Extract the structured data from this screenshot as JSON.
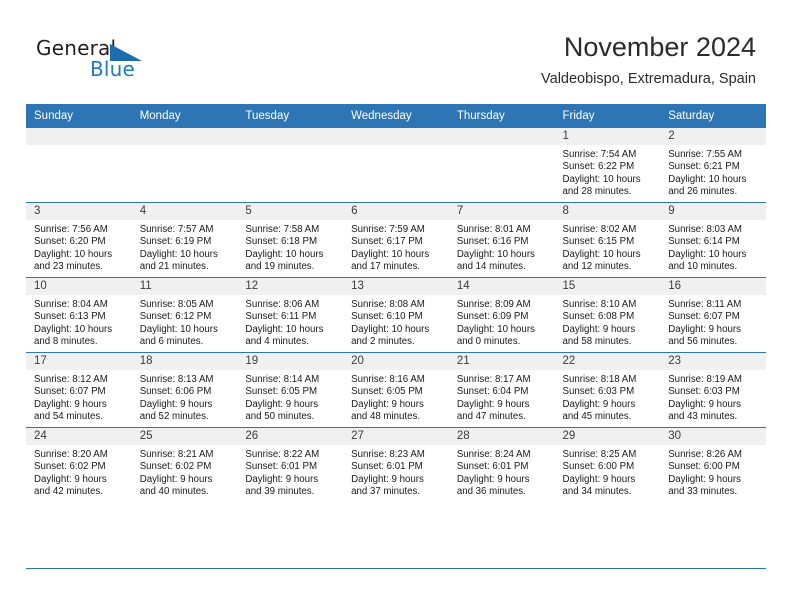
{
  "brand": {
    "name_part1": "General",
    "name_part2": "Blue",
    "logo_icon": "triangle-logo-icon",
    "accent_color": "#1d6cb0"
  },
  "header": {
    "title": "November 2024",
    "location": "Valdeobispo, Extremadura, Spain"
  },
  "theme": {
    "header_blue": "#2e75b6",
    "daynum_band": "#f0f0f0",
    "text": "#1a1a1a"
  },
  "weekday_headers": [
    "Sunday",
    "Monday",
    "Tuesday",
    "Wednesday",
    "Thursday",
    "Friday",
    "Saturday"
  ],
  "weeks": [
    [
      {
        "day": "",
        "sunrise": "",
        "sunset": "",
        "daylight_line1": "",
        "daylight_line2": ""
      },
      {
        "day": "",
        "sunrise": "",
        "sunset": "",
        "daylight_line1": "",
        "daylight_line2": ""
      },
      {
        "day": "",
        "sunrise": "",
        "sunset": "",
        "daylight_line1": "",
        "daylight_line2": ""
      },
      {
        "day": "",
        "sunrise": "",
        "sunset": "",
        "daylight_line1": "",
        "daylight_line2": ""
      },
      {
        "day": "",
        "sunrise": "",
        "sunset": "",
        "daylight_line1": "",
        "daylight_line2": ""
      },
      {
        "day": "1",
        "sunrise": "Sunrise: 7:54 AM",
        "sunset": "Sunset: 6:22 PM",
        "daylight_line1": "Daylight: 10 hours",
        "daylight_line2": "and 28 minutes."
      },
      {
        "day": "2",
        "sunrise": "Sunrise: 7:55 AM",
        "sunset": "Sunset: 6:21 PM",
        "daylight_line1": "Daylight: 10 hours",
        "daylight_line2": "and 26 minutes."
      }
    ],
    [
      {
        "day": "3",
        "sunrise": "Sunrise: 7:56 AM",
        "sunset": "Sunset: 6:20 PM",
        "daylight_line1": "Daylight: 10 hours",
        "daylight_line2": "and 23 minutes."
      },
      {
        "day": "4",
        "sunrise": "Sunrise: 7:57 AM",
        "sunset": "Sunset: 6:19 PM",
        "daylight_line1": "Daylight: 10 hours",
        "daylight_line2": "and 21 minutes."
      },
      {
        "day": "5",
        "sunrise": "Sunrise: 7:58 AM",
        "sunset": "Sunset: 6:18 PM",
        "daylight_line1": "Daylight: 10 hours",
        "daylight_line2": "and 19 minutes."
      },
      {
        "day": "6",
        "sunrise": "Sunrise: 7:59 AM",
        "sunset": "Sunset: 6:17 PM",
        "daylight_line1": "Daylight: 10 hours",
        "daylight_line2": "and 17 minutes."
      },
      {
        "day": "7",
        "sunrise": "Sunrise: 8:01 AM",
        "sunset": "Sunset: 6:16 PM",
        "daylight_line1": "Daylight: 10 hours",
        "daylight_line2": "and 14 minutes."
      },
      {
        "day": "8",
        "sunrise": "Sunrise: 8:02 AM",
        "sunset": "Sunset: 6:15 PM",
        "daylight_line1": "Daylight: 10 hours",
        "daylight_line2": "and 12 minutes."
      },
      {
        "day": "9",
        "sunrise": "Sunrise: 8:03 AM",
        "sunset": "Sunset: 6:14 PM",
        "daylight_line1": "Daylight: 10 hours",
        "daylight_line2": "and 10 minutes."
      }
    ],
    [
      {
        "day": "10",
        "sunrise": "Sunrise: 8:04 AM",
        "sunset": "Sunset: 6:13 PM",
        "daylight_line1": "Daylight: 10 hours",
        "daylight_line2": "and 8 minutes."
      },
      {
        "day": "11",
        "sunrise": "Sunrise: 8:05 AM",
        "sunset": "Sunset: 6:12 PM",
        "daylight_line1": "Daylight: 10 hours",
        "daylight_line2": "and 6 minutes."
      },
      {
        "day": "12",
        "sunrise": "Sunrise: 8:06 AM",
        "sunset": "Sunset: 6:11 PM",
        "daylight_line1": "Daylight: 10 hours",
        "daylight_line2": "and 4 minutes."
      },
      {
        "day": "13",
        "sunrise": "Sunrise: 8:08 AM",
        "sunset": "Sunset: 6:10 PM",
        "daylight_line1": "Daylight: 10 hours",
        "daylight_line2": "and 2 minutes."
      },
      {
        "day": "14",
        "sunrise": "Sunrise: 8:09 AM",
        "sunset": "Sunset: 6:09 PM",
        "daylight_line1": "Daylight: 10 hours",
        "daylight_line2": "and 0 minutes."
      },
      {
        "day": "15",
        "sunrise": "Sunrise: 8:10 AM",
        "sunset": "Sunset: 6:08 PM",
        "daylight_line1": "Daylight: 9 hours",
        "daylight_line2": "and 58 minutes."
      },
      {
        "day": "16",
        "sunrise": "Sunrise: 8:11 AM",
        "sunset": "Sunset: 6:07 PM",
        "daylight_line1": "Daylight: 9 hours",
        "daylight_line2": "and 56 minutes."
      }
    ],
    [
      {
        "day": "17",
        "sunrise": "Sunrise: 8:12 AM",
        "sunset": "Sunset: 6:07 PM",
        "daylight_line1": "Daylight: 9 hours",
        "daylight_line2": "and 54 minutes."
      },
      {
        "day": "18",
        "sunrise": "Sunrise: 8:13 AM",
        "sunset": "Sunset: 6:06 PM",
        "daylight_line1": "Daylight: 9 hours",
        "daylight_line2": "and 52 minutes."
      },
      {
        "day": "19",
        "sunrise": "Sunrise: 8:14 AM",
        "sunset": "Sunset: 6:05 PM",
        "daylight_line1": "Daylight: 9 hours",
        "daylight_line2": "and 50 minutes."
      },
      {
        "day": "20",
        "sunrise": "Sunrise: 8:16 AM",
        "sunset": "Sunset: 6:05 PM",
        "daylight_line1": "Daylight: 9 hours",
        "daylight_line2": "and 48 minutes."
      },
      {
        "day": "21",
        "sunrise": "Sunrise: 8:17 AM",
        "sunset": "Sunset: 6:04 PM",
        "daylight_line1": "Daylight: 9 hours",
        "daylight_line2": "and 47 minutes."
      },
      {
        "day": "22",
        "sunrise": "Sunrise: 8:18 AM",
        "sunset": "Sunset: 6:03 PM",
        "daylight_line1": "Daylight: 9 hours",
        "daylight_line2": "and 45 minutes."
      },
      {
        "day": "23",
        "sunrise": "Sunrise: 8:19 AM",
        "sunset": "Sunset: 6:03 PM",
        "daylight_line1": "Daylight: 9 hours",
        "daylight_line2": "and 43 minutes."
      }
    ],
    [
      {
        "day": "24",
        "sunrise": "Sunrise: 8:20 AM",
        "sunset": "Sunset: 6:02 PM",
        "daylight_line1": "Daylight: 9 hours",
        "daylight_line2": "and 42 minutes."
      },
      {
        "day": "25",
        "sunrise": "Sunrise: 8:21 AM",
        "sunset": "Sunset: 6:02 PM",
        "daylight_line1": "Daylight: 9 hours",
        "daylight_line2": "and 40 minutes."
      },
      {
        "day": "26",
        "sunrise": "Sunrise: 8:22 AM",
        "sunset": "Sunset: 6:01 PM",
        "daylight_line1": "Daylight: 9 hours",
        "daylight_line2": "and 39 minutes."
      },
      {
        "day": "27",
        "sunrise": "Sunrise: 8:23 AM",
        "sunset": "Sunset: 6:01 PM",
        "daylight_line1": "Daylight: 9 hours",
        "daylight_line2": "and 37 minutes."
      },
      {
        "day": "28",
        "sunrise": "Sunrise: 8:24 AM",
        "sunset": "Sunset: 6:01 PM",
        "daylight_line1": "Daylight: 9 hours",
        "daylight_line2": "and 36 minutes."
      },
      {
        "day": "29",
        "sunrise": "Sunrise: 8:25 AM",
        "sunset": "Sunset: 6:00 PM",
        "daylight_line1": "Daylight: 9 hours",
        "daylight_line2": "and 34 minutes."
      },
      {
        "day": "30",
        "sunrise": "Sunrise: 8:26 AM",
        "sunset": "Sunset: 6:00 PM",
        "daylight_line1": "Daylight: 9 hours",
        "daylight_line2": "and 33 minutes."
      }
    ]
  ]
}
